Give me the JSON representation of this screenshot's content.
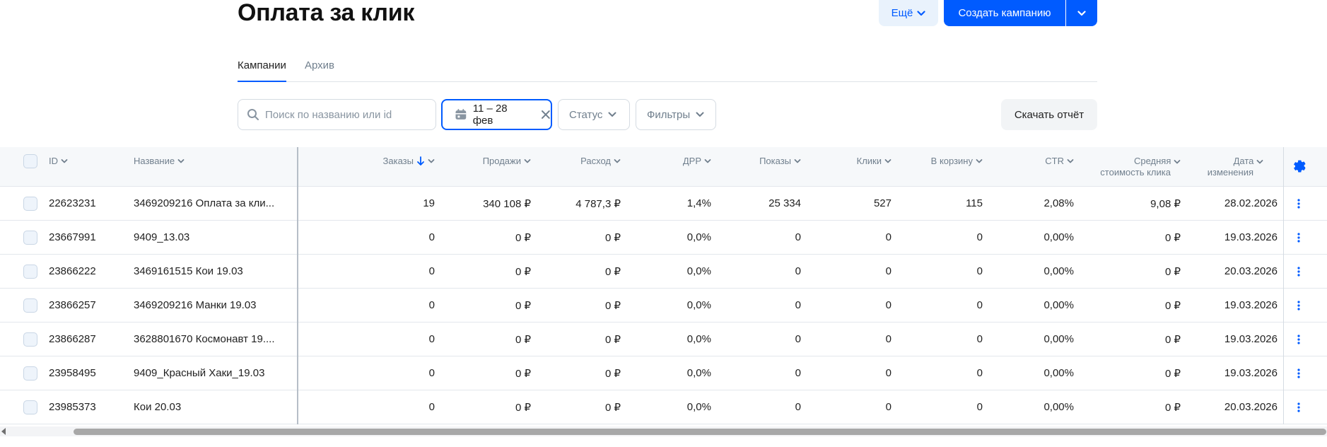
{
  "header": {
    "title": "Оплата за клик",
    "more_label": "Ещё",
    "create_label": "Создать кампанию"
  },
  "tabs": [
    {
      "label": "Кампании",
      "active": true
    },
    {
      "label": "Архив",
      "active": false
    }
  ],
  "filters": {
    "search_placeholder": "Поиск по названию или id",
    "date_range": "11 – 28 фев",
    "status_label": "Статус",
    "filters_label": "Фильтры",
    "download_label": "Скачать отчёт"
  },
  "table": {
    "columns": {
      "id": "ID",
      "name": "Название",
      "orders": "Заказы",
      "sales": "Продажи",
      "spend": "Расход",
      "drr": "ДРР",
      "impressions": "Показы",
      "clicks": "Клики",
      "to_cart": "В корзину",
      "ctr": "CTR",
      "avg_cpc_line1": "Средняя",
      "avg_cpc_line2": "стоимость клика",
      "date_line1": "Дата",
      "date_line2": "изменения"
    },
    "rows": [
      {
        "id": "22623231",
        "name": "3469209216 Оплата за кли...",
        "orders": "19",
        "sales": "340 108 ₽",
        "spend": "4 787,3 ₽",
        "drr": "1,4%",
        "impressions": "25 334",
        "clicks": "527",
        "to_cart": "115",
        "ctr": "2,08%",
        "avg_cpc": "9,08 ₽",
        "date": "28.02.2026"
      },
      {
        "id": "23667991",
        "name": "9409_13.03",
        "orders": "0",
        "sales": "0 ₽",
        "spend": "0 ₽",
        "drr": "0,0%",
        "impressions": "0",
        "clicks": "0",
        "to_cart": "0",
        "ctr": "0,00%",
        "avg_cpc": "0 ₽",
        "date": "19.03.2026"
      },
      {
        "id": "23866222",
        "name": "3469161515 Кои 19.03",
        "orders": "0",
        "sales": "0 ₽",
        "spend": "0 ₽",
        "drr": "0,0%",
        "impressions": "0",
        "clicks": "0",
        "to_cart": "0",
        "ctr": "0,00%",
        "avg_cpc": "0 ₽",
        "date": "20.03.2026"
      },
      {
        "id": "23866257",
        "name": "3469209216 Манки 19.03",
        "orders": "0",
        "sales": "0 ₽",
        "spend": "0 ₽",
        "drr": "0,0%",
        "impressions": "0",
        "clicks": "0",
        "to_cart": "0",
        "ctr": "0,00%",
        "avg_cpc": "0 ₽",
        "date": "19.03.2026"
      },
      {
        "id": "23866287",
        "name": "3628801670 Космонавт 19....",
        "orders": "0",
        "sales": "0 ₽",
        "spend": "0 ₽",
        "drr": "0,0%",
        "impressions": "0",
        "clicks": "0",
        "to_cart": "0",
        "ctr": "0,00%",
        "avg_cpc": "0 ₽",
        "date": "19.03.2026"
      },
      {
        "id": "23958495",
        "name": "9409_Красный Хаки_19.03",
        "orders": "0",
        "sales": "0 ₽",
        "spend": "0 ₽",
        "drr": "0,0%",
        "impressions": "0",
        "clicks": "0",
        "to_cart": "0",
        "ctr": "0,00%",
        "avg_cpc": "0 ₽",
        "date": "19.03.2026"
      },
      {
        "id": "23985373",
        "name": "Кои 20.03",
        "orders": "0",
        "sales": "0 ₽",
        "spend": "0 ₽",
        "drr": "0,0%",
        "impressions": "0",
        "clicks": "0",
        "to_cart": "0",
        "ctr": "0,00%",
        "avg_cpc": "0 ₽",
        "date": "20.03.2026"
      }
    ]
  },
  "colors": {
    "accent": "#005bff",
    "header_bg": "#f6f8fa",
    "muted_text": "#707f8d"
  },
  "icons": {
    "search": "search-icon",
    "calendar": "calendar-icon",
    "clear": "close-icon",
    "chevron": "chevron-down-icon",
    "sort": "arrow-down-icon",
    "settings": "gear-icon",
    "row_menu": "more-vertical-icon"
  }
}
